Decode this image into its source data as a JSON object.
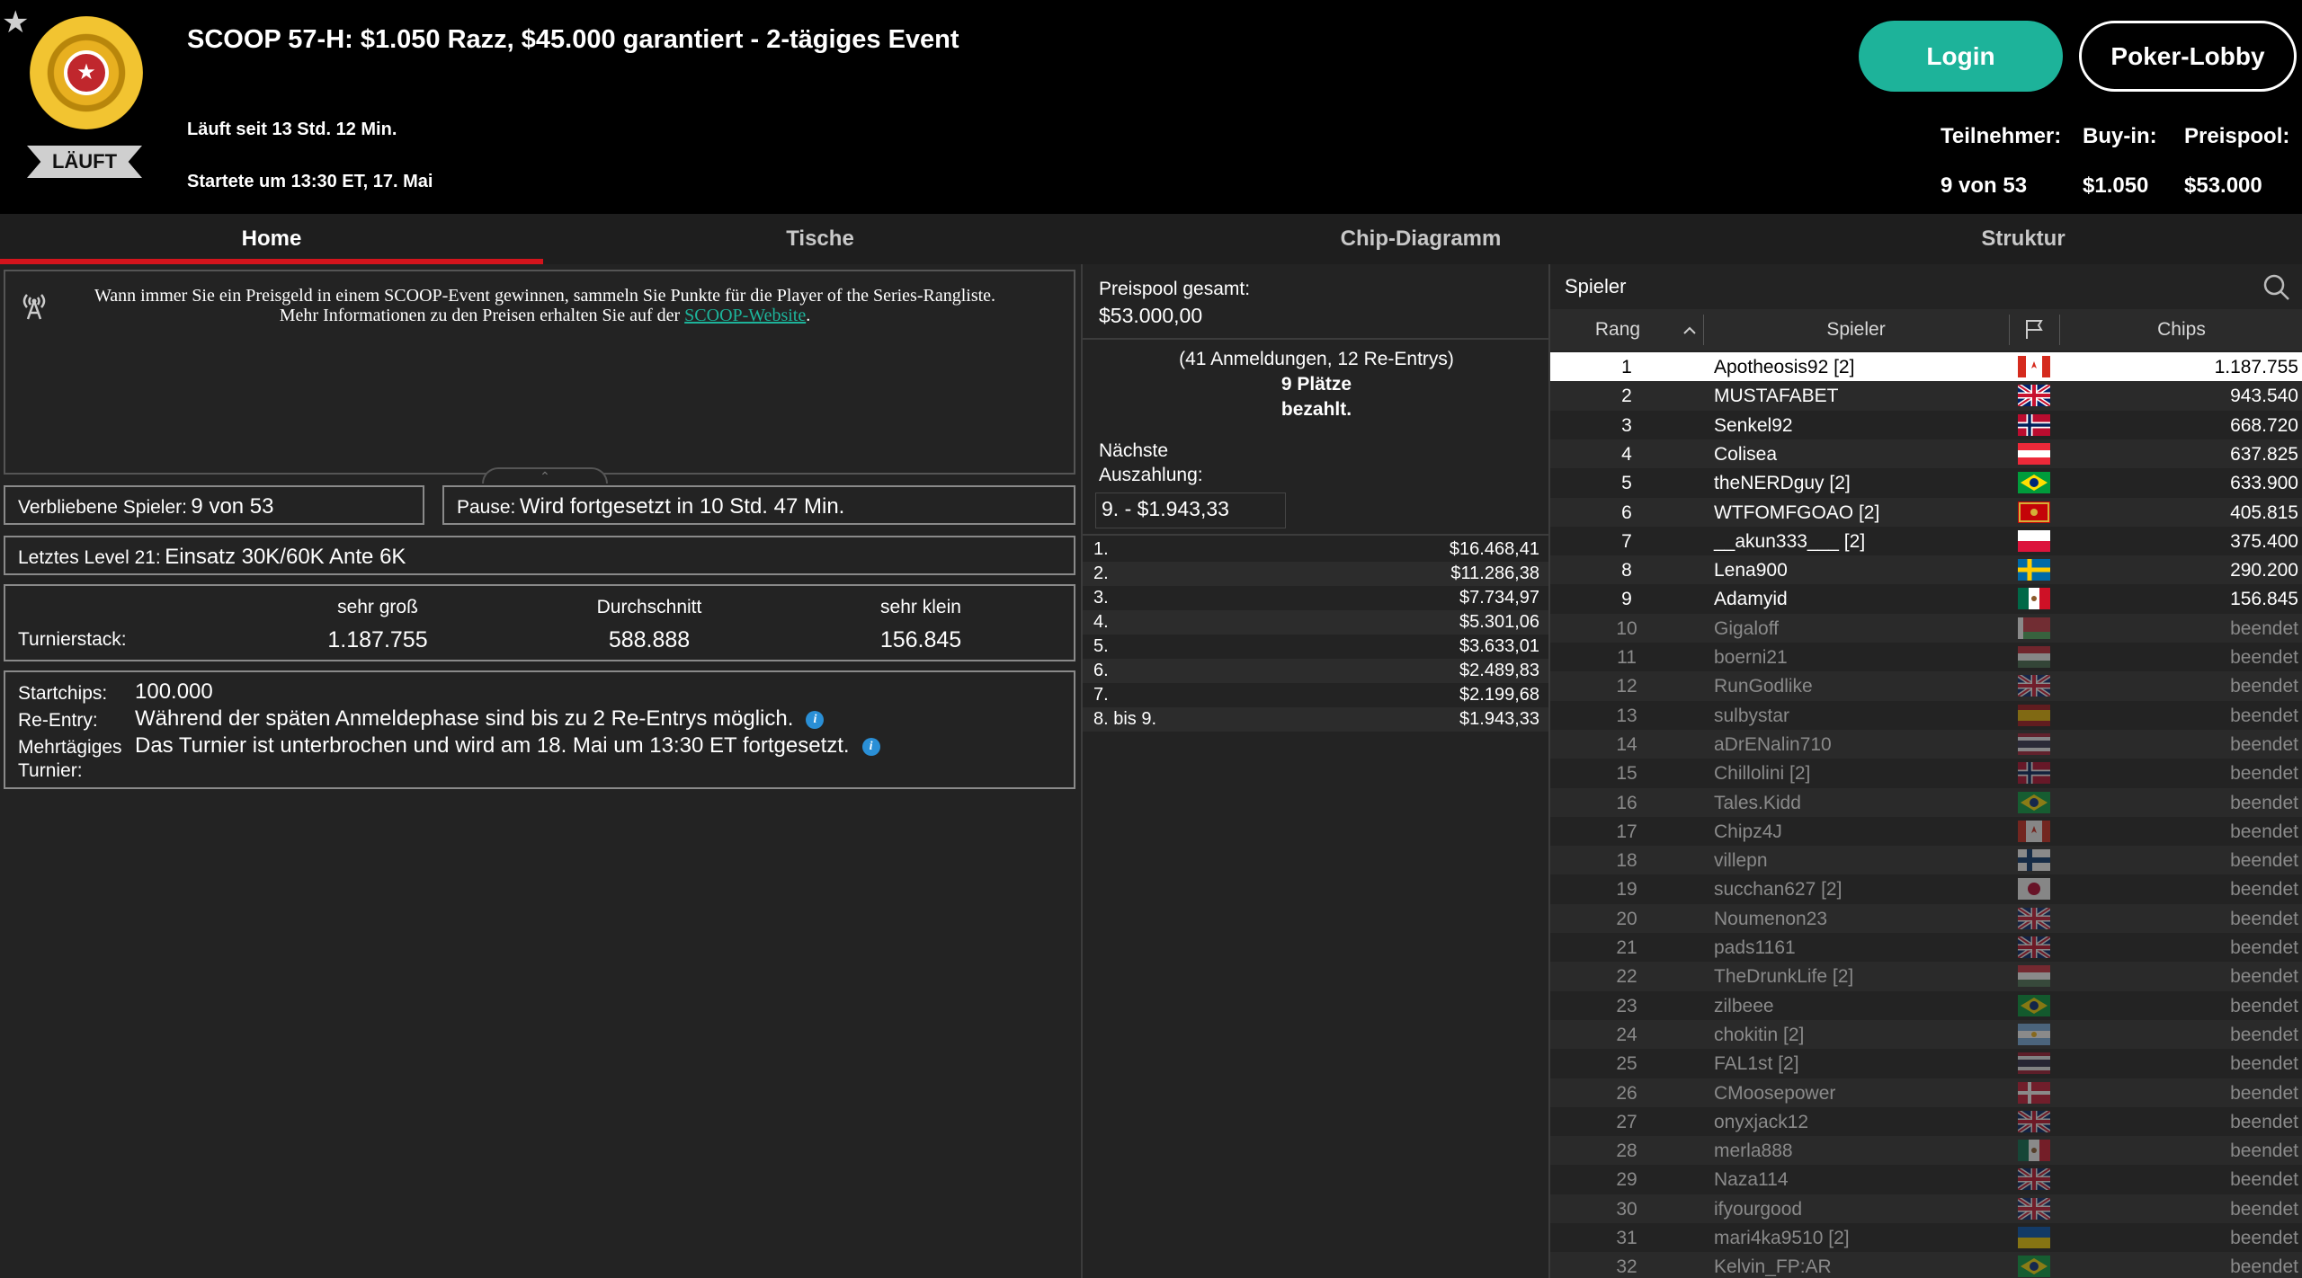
{
  "header": {
    "title": "SCOOP 57-H: $1.050 Razz, $45.000 garantiert - 2-tägiges Event",
    "status": "LÄUFT",
    "running_for": "Läuft seit 13 Std. 12 Min.",
    "started_at": "Startete um 13:30 ET, 17. Mai",
    "login_label": "Login",
    "lobby_label": "Poker-Lobby",
    "stats": {
      "participants_label": "Teilnehmer:",
      "participants_value": "9 von 53",
      "buyin_label": "Buy-in:",
      "buyin_value": "$1.050",
      "prizepool_label": "Preispool:",
      "prizepool_value": "$53.000"
    }
  },
  "tabs": [
    {
      "label": "Home"
    },
    {
      "label": "Tische"
    },
    {
      "label": "Chip-Diagramm"
    },
    {
      "label": "Struktur"
    }
  ],
  "home": {
    "info_text": "Wann immer Sie ein Preisgeld in einem SCOOP-Event gewinnen, sammeln Sie Punkte für die Player of the Series-Rangliste. Mehr Informationen zu den Preisen erhalten Sie auf der",
    "info_link": "SCOOP-Website",
    "info_end": ".",
    "remaining_label": "Verbliebene Spieler:",
    "remaining_value": "9 von 53",
    "pause_label": "Pause:",
    "pause_value": "Wird fortgesetzt in 10 Std. 47 Min.",
    "level_label": "Letztes Level 21:",
    "level_value": "Einsatz 30K/60K Ante 6K",
    "stack_label": "Turnierstack:",
    "stack_cols": [
      {
        "head": "sehr groß",
        "value": "1.187.755"
      },
      {
        "head": "Durchschnitt",
        "value": "588.888"
      },
      {
        "head": "sehr klein",
        "value": "156.845"
      }
    ],
    "startchips_label": "Startchips:",
    "startchips_value": "100.000",
    "reentry_label": "Re-Entry:",
    "reentry_value": "Während der späten Anmeldephase sind bis zu 2 Re-Entrys möglich.",
    "multiday_label1": "Mehrtägiges",
    "multiday_label2": "Turnier:",
    "multiday_value": "Das Turnier ist unterbrochen und wird am 18. Mai um 13:30 ET fortgesetzt."
  },
  "prizes": {
    "pool_label": "Preispool gesamt:",
    "pool_value": "$53.000,00",
    "entries_line": "(41 Anmeldungen, 12 Re-Entrys)",
    "places_line1": "9 Plätze",
    "places_line2": "bezahlt.",
    "next_label1": "Nächste",
    "next_label2": "Auszahlung:",
    "next_value": "9. - $1.943,33",
    "payouts": [
      {
        "place": "1.",
        "amount": "$16.468,41"
      },
      {
        "place": "2.",
        "amount": "$11.286,38"
      },
      {
        "place": "3.",
        "amount": "$7.734,97"
      },
      {
        "place": "4.",
        "amount": "$5.301,06"
      },
      {
        "place": "5.",
        "amount": "$3.633,01"
      },
      {
        "place": "6.",
        "amount": "$2.489,83"
      },
      {
        "place": "7.",
        "amount": "$2.199,68"
      },
      {
        "place": "8. bis 9.",
        "amount": "$1.943,33"
      }
    ]
  },
  "players": {
    "title": "Spieler",
    "headers": {
      "rank": "Rang",
      "player": "Spieler",
      "chips": "Chips"
    },
    "rows": [
      {
        "rank": "1",
        "name": "Apotheosis92 [2]",
        "flag": "ca",
        "chips": "1.187.755"
      },
      {
        "rank": "2",
        "name": "MUSTAFABET",
        "flag": "uk",
        "chips": "943.540"
      },
      {
        "rank": "3",
        "name": "Senkel92",
        "flag": "no",
        "chips": "668.720"
      },
      {
        "rank": "4",
        "name": "Colisea",
        "flag": "at",
        "chips": "637.825"
      },
      {
        "rank": "5",
        "name": "theNERDguy [2]",
        "flag": "br",
        "chips": "633.900"
      },
      {
        "rank": "6",
        "name": "WTFOMFGOAO [2]",
        "flag": "me",
        "chips": "405.815"
      },
      {
        "rank": "7",
        "name": "__akun333___ [2]",
        "flag": "pl",
        "chips": "375.400"
      },
      {
        "rank": "8",
        "name": "Lena900",
        "flag": "se",
        "chips": "290.200"
      },
      {
        "rank": "9",
        "name": "Adamyid",
        "flag": "mx",
        "chips": "156.845"
      },
      {
        "rank": "10",
        "name": "Gigaloff",
        "flag": "by",
        "chips": "beendet"
      },
      {
        "rank": "11",
        "name": "boerni21",
        "flag": "hu",
        "chips": "beendet"
      },
      {
        "rank": "12",
        "name": "RunGodlike",
        "flag": "uk",
        "chips": "beendet"
      },
      {
        "rank": "13",
        "name": "sulbystar",
        "flag": "es",
        "chips": "beendet"
      },
      {
        "rank": "14",
        "name": "aDrENalin710",
        "flag": "th",
        "chips": "beendet"
      },
      {
        "rank": "15",
        "name": "Chillolini [2]",
        "flag": "no",
        "chips": "beendet"
      },
      {
        "rank": "16",
        "name": "Tales.Kidd",
        "flag": "br",
        "chips": "beendet"
      },
      {
        "rank": "17",
        "name": "Chipz4J",
        "flag": "ca",
        "chips": "beendet"
      },
      {
        "rank": "18",
        "name": "villepn",
        "flag": "fi",
        "chips": "beendet"
      },
      {
        "rank": "19",
        "name": "succhan627 [2]",
        "flag": "jp",
        "chips": "beendet"
      },
      {
        "rank": "20",
        "name": "Noumenon23",
        "flag": "uk",
        "chips": "beendet"
      },
      {
        "rank": "21",
        "name": "pads1161",
        "flag": "uk",
        "chips": "beendet"
      },
      {
        "rank": "22",
        "name": "TheDrunkLife [2]",
        "flag": "hu",
        "chips": "beendet"
      },
      {
        "rank": "23",
        "name": "zilbeee",
        "flag": "br",
        "chips": "beendet"
      },
      {
        "rank": "24",
        "name": "chokitin [2]",
        "flag": "ar",
        "chips": "beendet"
      },
      {
        "rank": "25",
        "name": "FAL1st [2]",
        "flag": "th",
        "chips": "beendet"
      },
      {
        "rank": "26",
        "name": "CMoosepower",
        "flag": "dk",
        "chips": "beendet"
      },
      {
        "rank": "27",
        "name": "onyxjack12",
        "flag": "uk",
        "chips": "beendet"
      },
      {
        "rank": "28",
        "name": "merla888",
        "flag": "mx",
        "chips": "beendet"
      },
      {
        "rank": "29",
        "name": "Naza114",
        "flag": "uk",
        "chips": "beendet"
      },
      {
        "rank": "30",
        "name": "ifyourgood",
        "flag": "uk",
        "chips": "beendet"
      },
      {
        "rank": "31",
        "name": "mari4ka9510 [2]",
        "flag": "ua",
        "chips": "beendet"
      },
      {
        "rank": "32",
        "name": "Kelvin_FP:AR",
        "flag": "br",
        "chips": "beendet"
      }
    ]
  },
  "colors": {
    "accent": "#1db39a",
    "tab_active": "#d4141c",
    "info": "#2a8fd6"
  }
}
